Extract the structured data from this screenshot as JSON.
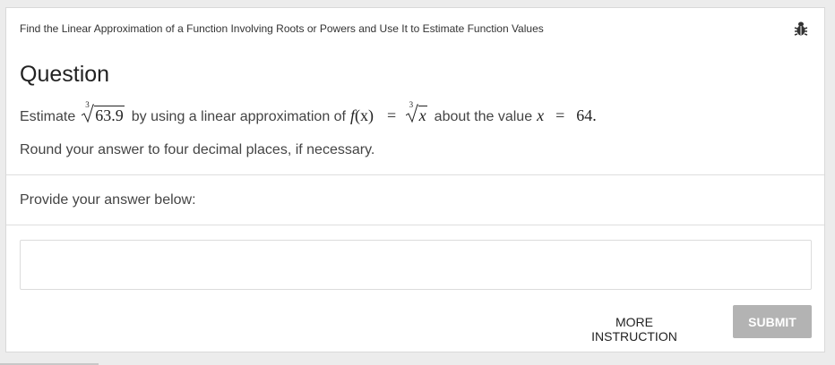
{
  "header": {
    "title": "Find the Linear Approximation of a Function Involving Roots or Powers and Use It to Estimate Function Values"
  },
  "question": {
    "heading": "Question",
    "estimate_word": "Estimate",
    "root_index": "3",
    "root_value": "63.9",
    "mid_text": "by using a linear approximation of",
    "func_name": "f",
    "func_arg": "(x)",
    "equals": "=",
    "root_var": "x",
    "about_text": "about the value",
    "value_var": "x",
    "value_equals": "=",
    "value_num": "64",
    "period": ".",
    "rounding": "Round your answer to four decimal places, if necessary."
  },
  "answer": {
    "prompt": "Provide your answer below:",
    "value": ""
  },
  "buttons": {
    "more_instruction": "MORE INSTRUCTION",
    "submit": "SUBMIT"
  },
  "colors": {
    "submit_bg": "#b3b3b3",
    "card_bg": "#ffffff",
    "page_bg": "#ececec"
  },
  "icons": {
    "report": "bug-icon"
  }
}
